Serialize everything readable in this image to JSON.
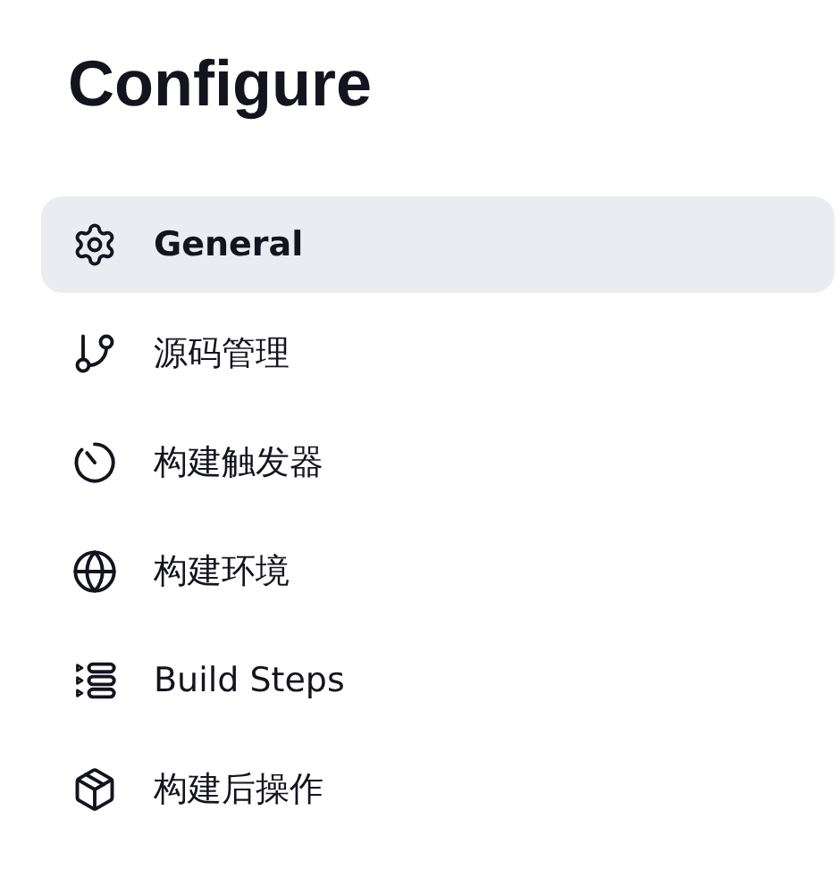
{
  "title": "Configure",
  "nav": [
    {
      "label": "General",
      "kind": "gear",
      "selected": true
    },
    {
      "label": "源码管理",
      "kind": "branch",
      "selected": false
    },
    {
      "label": "构建触发器",
      "kind": "timer",
      "selected": false
    },
    {
      "label": "构建环境",
      "kind": "globe",
      "selected": false
    },
    {
      "label": "Build Steps",
      "kind": "steps",
      "selected": false
    },
    {
      "label": "构建后操作",
      "kind": "package",
      "selected": false
    }
  ]
}
